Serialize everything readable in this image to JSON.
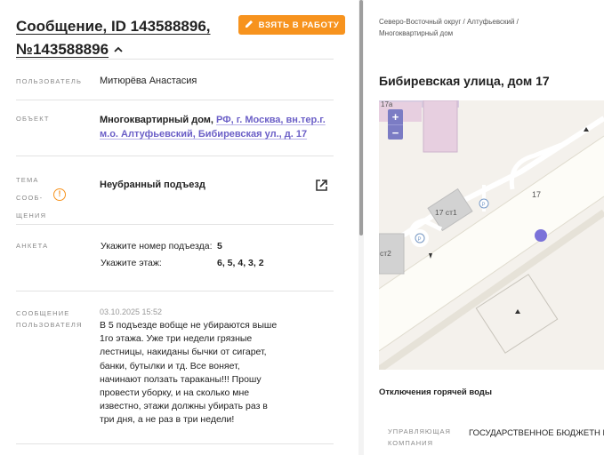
{
  "message": {
    "title": "Сообщение, ID 143588896, №143588896",
    "take_button": "ВЗЯТЬ В РАБОТУ"
  },
  "fields": {
    "user_label": "ПОЛЬЗОВАТЕЛЬ",
    "user_value": "Митюрёва Анастасия",
    "object_label": "ОБЪЕКТ",
    "object_type": "Многоквартирный дом,",
    "object_address": "РФ, г. Москва, вн.тер.г. м.о. Алтуфьевский, Бибиревская ул., д. 17",
    "topic_label": "ТЕМА СООБ- ЩЕНИЯ",
    "topic_value": "Неубранный подъезд",
    "survey_label": "АНКЕТА",
    "survey": [
      {
        "question": "Укажите номер подъезда:",
        "answer": "5"
      },
      {
        "question": "Укажите этаж:",
        "answer": "6, 5, 4, 3, 2"
      }
    ],
    "user_msg_label": "СООБЩЕНИЕ ПОЛЬЗОВАТЕЛЯ",
    "user_msg_date": "03.10.2025 15:52",
    "user_msg_text": "В 5 подъезде вобще не убираются выше 1го этажа. Уже три недели грязные лестницы, накиданы бычки от сигарет, банки, бутылки и тд. Все воняет, начинают ползать тараканы!!! Прошу провести уборку, и на сколько мне известно, этажи должны убирать раз в три дня, а не раз в три недели!"
  },
  "right": {
    "breadcrumb": "Северо-Восточный округ / Алтуфьевский / Многоквартирный дом",
    "address_title": "Бибиревская улица, дом 17",
    "map": {
      "zoom_in": "+",
      "zoom_out": "−",
      "labels": {
        "b17": "17",
        "b17st1": "17 ст1",
        "st2": "ст2",
        "b17a": "17а",
        "p1": "P",
        "p2": "P"
      }
    },
    "outage_title": "Отключения горячей воды",
    "mgmt_label": "УПРАВЛЯЮЩАЯ КОМПАНИЯ",
    "mgmt_value": "ГОСУДАРСТВЕННОЕ БЮДЖЕТН ГОРОДА МОСКВЫ «ЖИЛИЩНИ"
  },
  "colors": {
    "accent": "#f7931e",
    "link": "#6b5fc7",
    "map_marker": "#7b72d9"
  }
}
